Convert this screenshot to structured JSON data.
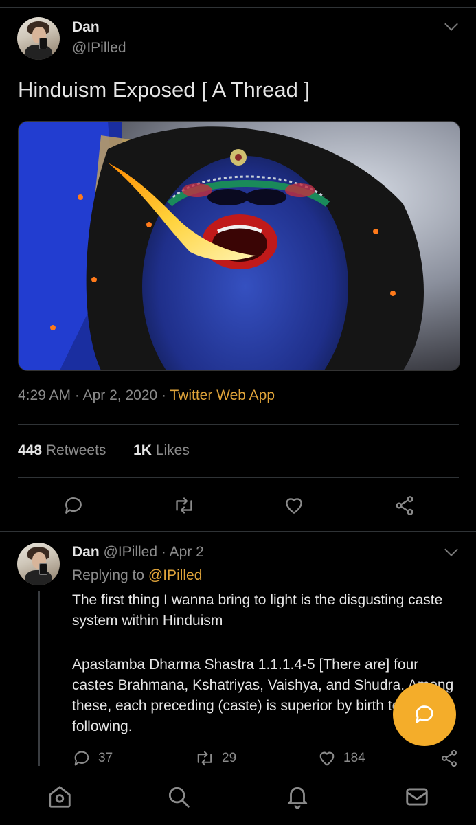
{
  "tweet": {
    "author_name": "Dan",
    "author_handle": "@IPilled",
    "text": "Hinduism Exposed [ A Thread ]",
    "time": "4:29 AM",
    "date": "Apr 2, 2020",
    "separator": "·",
    "source": "Twitter Web App",
    "retweets_count": "448",
    "retweets_label": "Retweets",
    "likes_count": "1K",
    "likes_label": "Likes"
  },
  "reply": {
    "author_name": "Dan",
    "author_handle": "@IPilled",
    "date": "· Apr 2",
    "replying_prefix": "Replying to",
    "replying_handle": "@IPilled",
    "paragraph1": "The first thing I wanna bring to light is the disgusting caste system within Hinduism",
    "paragraph2": "Apastamba Dharma Shastra 1.1.1.4-5 [There are] four castes Brahmana, Kshatriyas, Vaishya, and Shudra. Among these, each preceding (caste) is superior by birth to the one following.",
    "reply_count": "37",
    "retweet_count": "29",
    "like_count": "184"
  },
  "colors": {
    "background": "#000000",
    "accent": "#e0a43a",
    "fab": "#f4ad2a",
    "muted": "#8b8b8b"
  },
  "icons": {
    "reply": "speech-bubble-icon",
    "retweet": "retweet-icon",
    "like": "heart-icon",
    "share": "share-icon",
    "home": "home-icon",
    "search": "search-icon",
    "notifications": "bell-icon",
    "messages": "mail-icon",
    "compose": "compose-reply-icon"
  }
}
